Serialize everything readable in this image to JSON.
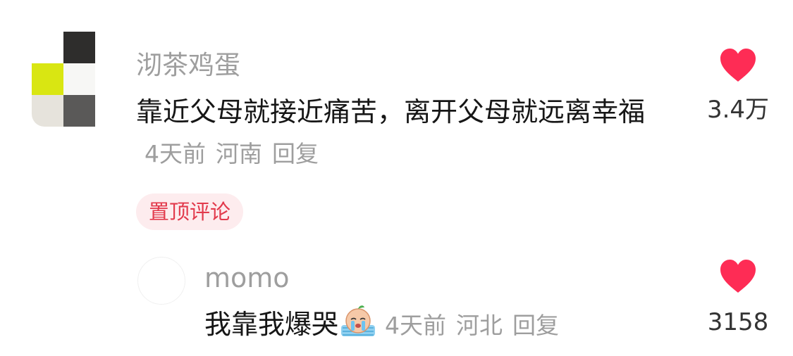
{
  "main_comment": {
    "username": "沏茶鸡蛋",
    "text": "靠近父母就接近痛苦，离开父母就远离幸福",
    "time": "4天前",
    "location": "河南",
    "reply_label": "回复",
    "pinned_label": "置顶评论",
    "like_count": "3.4万"
  },
  "reply": {
    "username": "momo",
    "text": "我靠我爆哭",
    "emoji": "crying-face-icon",
    "time": "4天前",
    "location": "河北",
    "reply_label": "回复",
    "like_count": "3158"
  },
  "colors": {
    "heart": "#fe2c55",
    "pinned_text": "#e23a4c",
    "pinned_bg": "#fdecee",
    "meta_text": "#9e9e9e"
  }
}
